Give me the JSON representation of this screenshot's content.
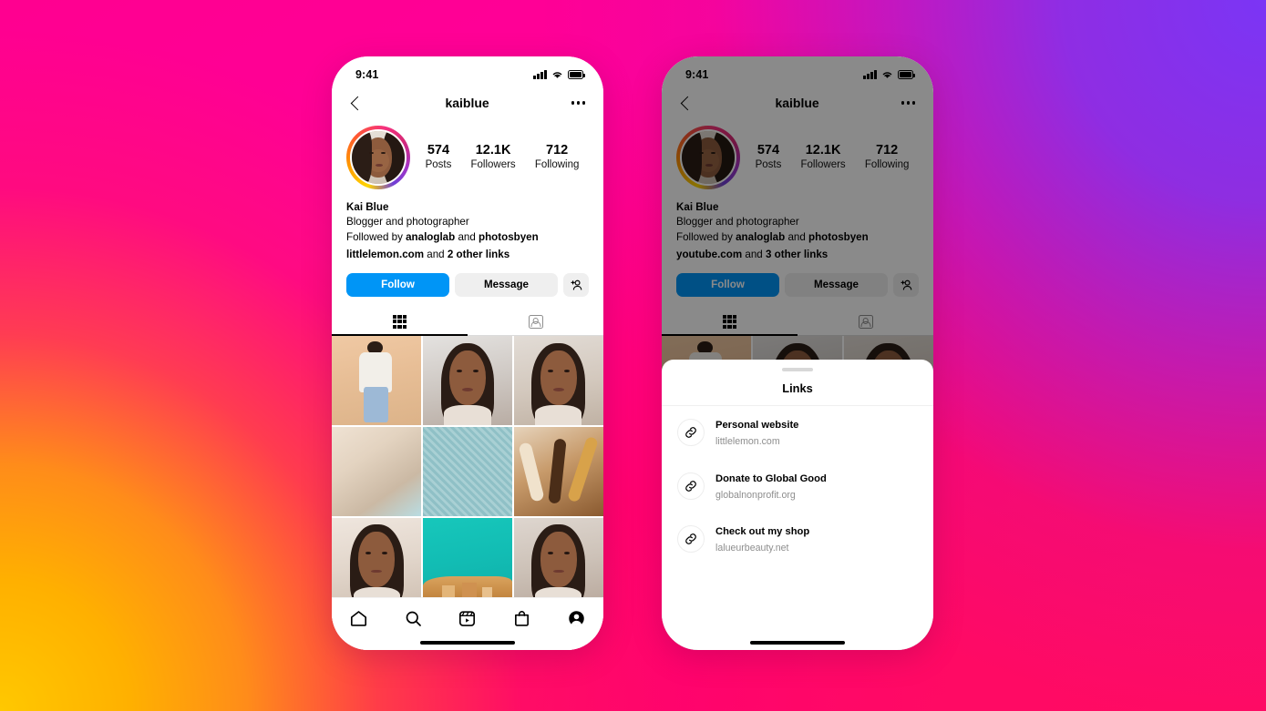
{
  "background": {
    "colors": [
      "#ff0090",
      "#7b35f5",
      "#ff0b63",
      "#ffc800",
      "#ff8c1a"
    ]
  },
  "accents": {
    "instagram_blue": "#0095f6",
    "light_grey_button": "#efefef",
    "secondary_text": "#8e8e8e"
  },
  "status_bar": {
    "time": "9:41",
    "signal_icon": "cellular-bars-icon",
    "wifi_icon": "wifi-icon",
    "battery_icon": "battery-full-icon"
  },
  "header": {
    "back_icon": "chevron-left-icon",
    "title": "kaiblue",
    "more_icon": "ellipsis-icon"
  },
  "profile": {
    "avatar_name": "avatar",
    "stats": [
      {
        "value": "574",
        "label": "Posts"
      },
      {
        "value": "12.1K",
        "label": "Followers"
      },
      {
        "value": "712",
        "label": "Following"
      }
    ],
    "name": "Kai Blue",
    "description": "Blogger and photographer",
    "followed_by_prefix": "Followed by ",
    "followed_by_user1": "analoglab",
    "followed_by_join": " and ",
    "followed_by_user2": "photosbyen"
  },
  "links_summary_left": {
    "primary_link": "littlelemon.com",
    "middle": " and ",
    "more": "2 other links"
  },
  "links_summary_right": {
    "primary_link": "youtube.com",
    "middle": " and ",
    "more": "3 other links"
  },
  "actions": {
    "follow_label": "Follow",
    "message_label": "Message",
    "add_person_icon": "add-person-icon"
  },
  "tabs": {
    "grid_icon": "grid-tab-icon",
    "tagged_icon": "tagged-tab-icon",
    "active": "grid"
  },
  "bottom_nav": {
    "items": [
      {
        "icon": "home-icon"
      },
      {
        "icon": "search-icon"
      },
      {
        "icon": "reels-icon"
      },
      {
        "icon": "shop-icon"
      },
      {
        "icon": "profile-icon"
      }
    ]
  },
  "sheet": {
    "grab_handle": "sheet-grab-handle",
    "title": "Links",
    "items": [
      {
        "icon": "link-icon",
        "title": "Personal website",
        "url": "littlelemon.com"
      },
      {
        "icon": "link-icon",
        "title": "Donate to Global Good",
        "url": "globalnonprofit.org"
      },
      {
        "icon": "link-icon",
        "title": "Check out my shop",
        "url": "lalueurbeauty.net"
      }
    ]
  },
  "photo_grid": {
    "cells": [
      {
        "name": "post-woman-white-coat",
        "css": "linear-gradient(170deg,#f0c9a4 0%,#e8bf97 40%,#dcb389 100%)",
        "figure": "portrait-standing"
      },
      {
        "name": "post-woman-cooking",
        "css": "linear-gradient(170deg,#e4e2e0 0%,#cfc9c4 50%,#b9ada4 100%)",
        "figure": "portrait-closeup"
      },
      {
        "name": "post-woman-tank-top",
        "css": "linear-gradient(170deg,#e2dcd6 0%,#d3c8bd 55%,#c0b2a4 100%)",
        "figure": "portrait-closeup"
      },
      {
        "name": "post-marble-texture",
        "css": "linear-gradient(145deg,#efe2d3 0%,#e3d3c0 35%,#cbb9a4 70%,#b9dce2 100%)",
        "figure": "texture"
      },
      {
        "name": "post-teal-weave-texture",
        "css": "repeating-linear-gradient(45deg,#8fc0c6 0 3px,#a9d0d4 3px 6px)",
        "figure": "texture"
      },
      {
        "name": "post-beauty-products",
        "css": "linear-gradient(155deg,#e6d3bb 0%,#c79a6a 45%,#8a5a30 100%)",
        "figure": "objects"
      },
      {
        "name": "post-woman-headband",
        "css": "linear-gradient(170deg,#efe6de 0%,#e2d6cb 50%,#cfc0b2 100%)",
        "figure": "portrait-closeup"
      },
      {
        "name": "post-coastal-sea",
        "css": "linear-gradient(170deg,#17c7bb 0%,#12bdb4 45%,#0fada8 100%)",
        "figure": "landscape"
      },
      {
        "name": "post-woman-long-hair",
        "css": "linear-gradient(170deg,#ded6cf 0%,#cdc2b8 50%,#b8a89c 100%)",
        "figure": "portrait-closeup"
      }
    ]
  }
}
